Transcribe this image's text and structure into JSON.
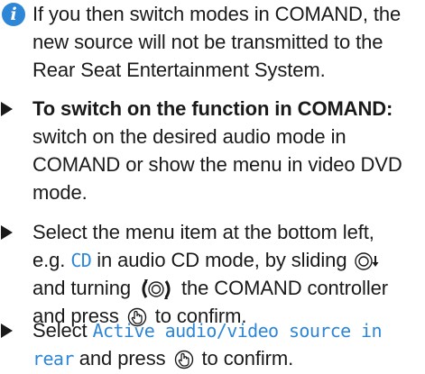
{
  "note": {
    "icon": "info-icon",
    "icon_glyph": "i",
    "text_line1": "If you then switch modes in COMAND, the",
    "text_line2": "new source will not be transmitted to the",
    "text_line3": "Rear Seat Entertainment System."
  },
  "steps": [
    {
      "bold_text": "To switch on the function in COMAND:",
      "text_line1": "switch on the desired audio mode in",
      "text_line2": "COMAND or show the menu in video DVD",
      "text_line3": "mode."
    },
    {
      "text_line1": "Select the menu item at the bottom left,",
      "text_prefix": "e.g. ",
      "display_text": "CD",
      "text_mid": " in audio CD mode, by sliding ",
      "text_line3_prefix": "and turning ",
      "text_line3_suffix": " the COMAND controller",
      "text_line4_prefix": "and press ",
      "text_line4_suffix": " to confirm."
    },
    {
      "text_prefix": "Select ",
      "display_text_line1": "Active audio/video source in",
      "display_text_line2": "rear",
      "text_suffix": " and press ",
      "text_end": " to confirm."
    }
  ],
  "icons": {
    "bullet": "triangle-bullet-icon",
    "slide_down": "controller-slide-down-icon",
    "turn": "controller-turn-icon",
    "press": "controller-press-icon"
  },
  "colors": {
    "accent": "#2e86d6",
    "text": "#1a1a1a"
  }
}
